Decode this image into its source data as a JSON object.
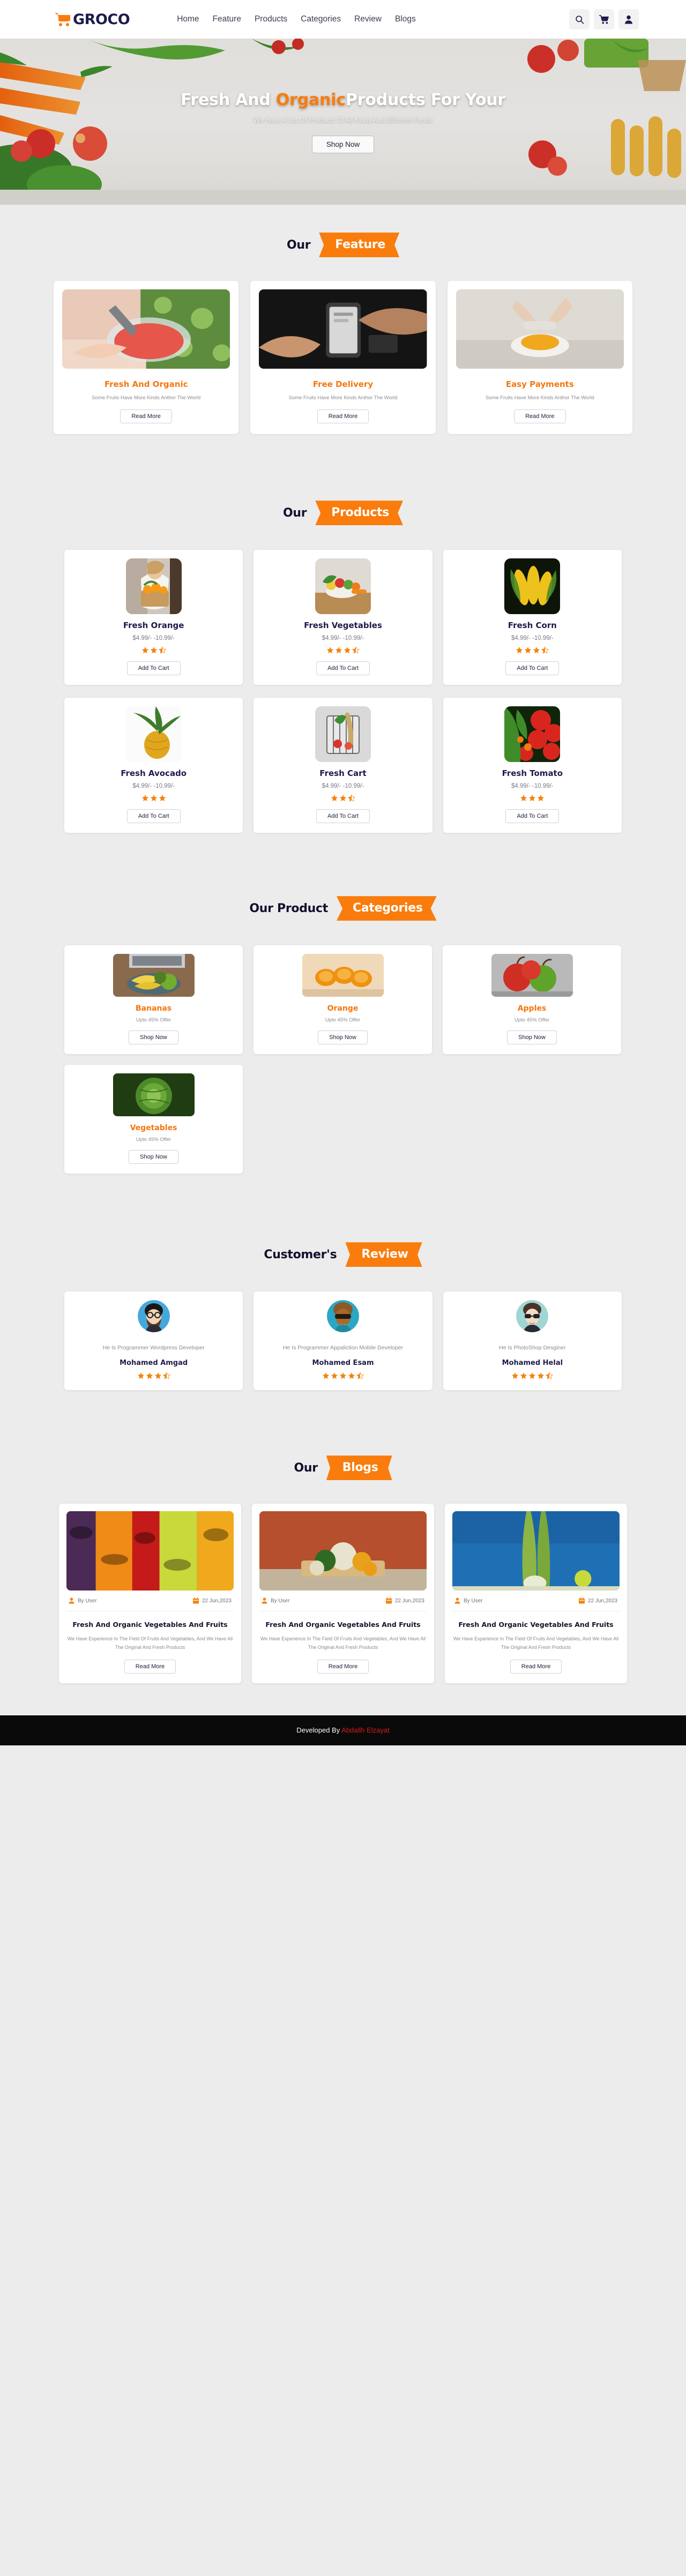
{
  "navbar": {
    "brand": "GROCO",
    "brand_icon": "shopping-cart-icon",
    "links": [
      {
        "label": "Home"
      },
      {
        "label": "Feature"
      },
      {
        "label": "Products"
      },
      {
        "label": "Categories"
      },
      {
        "label": "Review"
      },
      {
        "label": "Blogs"
      }
    ],
    "actions": [
      {
        "name": "search-icon",
        "title": "Search"
      },
      {
        "name": "cart-icon",
        "title": "Cart"
      },
      {
        "name": "user-icon",
        "title": "Account"
      }
    ]
  },
  "hero": {
    "title_pre": "Fresh And ",
    "title_highlight": "Organic",
    "title_post": "Products For Your",
    "subtitle": "We Have A Lot Of Products Of All Kinds And Different Foods",
    "cta": "Shop Now"
  },
  "feature": {
    "heading_pre": "Our",
    "heading_ribbon": "Feature",
    "read_more": "Read More",
    "items": [
      {
        "title": "Fresh And Organic",
        "desc": "Some Fruits Have More Kinds Anthor The World",
        "image": "watermelon-bowl-photo"
      },
      {
        "title": "Free Delivery",
        "desc": "Some Fruits Have More Kinds Anthor The World",
        "image": "mobile-payment-photo"
      },
      {
        "title": "Easy Payments",
        "desc": "Some Fruits Have More Kinds Anthor The World",
        "image": "juicer-photo"
      }
    ]
  },
  "products": {
    "heading_pre": "Our",
    "heading_ribbon": "Products",
    "add_to_cart": "Add To Cart",
    "items": [
      {
        "name": "Fresh Orange",
        "price": "$4.99/- -10.99/-",
        "rating": 2.5,
        "image": "woman-orange-basket-photo"
      },
      {
        "name": "Fresh Vegetables",
        "price": "$4.99/- -10.99/-",
        "rating": 3.5,
        "image": "vegetables-tray-photo"
      },
      {
        "name": "Fresh Corn",
        "price": "$4.99/- -10.99/-",
        "rating": 3.5,
        "image": "corn-photo"
      },
      {
        "name": "Fresh Avocado",
        "price": "$4.99/- -10.99/-",
        "rating": 3.0,
        "image": "pineapple-photo"
      },
      {
        "name": "Fresh Cart",
        "price": "$4.99/- -10.99/-",
        "rating": 2.5,
        "image": "grocery-cart-photo"
      },
      {
        "name": "Fresh Tomato",
        "price": "$4.99/- -10.99/-",
        "rating": 3.0,
        "image": "tomatoes-photo"
      }
    ]
  },
  "categories": {
    "heading_pre": "Our Product",
    "heading_ribbon": "Categories",
    "shop_now": "Shop Now",
    "items": [
      {
        "name": "Bananas",
        "offer": "Upto 45% Offer",
        "image": "bananas-plate-photo"
      },
      {
        "name": "Orange",
        "offer": "Upto 45% Offer",
        "image": "orange-slices-photo"
      },
      {
        "name": "Apples",
        "offer": "Upto 45% Offer",
        "image": "red-green-apples-photo"
      },
      {
        "name": "Vegetables",
        "offer": "Upto 45% Offer",
        "image": "cabbage-photo"
      }
    ]
  },
  "reviews": {
    "heading_pre": "Customer's",
    "heading_ribbon": "Review",
    "items": [
      {
        "role": "He Is Programmer Wordpress Developer",
        "name": "Mohamed Amgad",
        "rating": 3.5,
        "avatar": "bearded-man-avatar"
      },
      {
        "role": "He Is Programmer Appaliction Mobile Developer",
        "name": "Mohamed Esam",
        "rating": 4.5,
        "avatar": "sunglasses-man-avatar"
      },
      {
        "role": "He Is PhotoShop Desginer",
        "name": "Mohamed Helal",
        "rating": 4.5,
        "avatar": "glasses-man-avatar"
      }
    ]
  },
  "blogs": {
    "heading_pre": "Our",
    "heading_ribbon": "Blogs",
    "read_more": "Read More",
    "items": [
      {
        "author": "By User",
        "date": "22 Jun,2023",
        "title": "Fresh And Organic Vegetables And Fruits",
        "text": "We Have Experience In The Field Of Fruits And Vegetables, And We Have All The Original And Fresh Products",
        "image": "market-produce-photo"
      },
      {
        "author": "By User",
        "date": "22 Jun,2023",
        "title": "Fresh And Organic Vegetables And Fruits",
        "text": "We Have Experience In The Field Of Fruits And Vegetables, And We Have All The Original And Fresh Products",
        "image": "vegetable-basket-photo"
      },
      {
        "author": "By User",
        "date": "22 Jun,2023",
        "title": "Fresh And Organic Vegetables And Fruits",
        "text": "We Have Experience In The Field Of Fruits And Vegetables, And We Have All The Original And Fresh Products",
        "image": "leek-sky-photo"
      }
    ]
  },
  "footer": {
    "prefix": "Developed By ",
    "developer": "Abdallh Elzayat"
  },
  "colors": {
    "accent": "#f97c0c",
    "navy": "#1d1b4b",
    "page_bg": "#ececec",
    "footer_bg": "#0a0a0a",
    "developer_red": "#e01717"
  }
}
